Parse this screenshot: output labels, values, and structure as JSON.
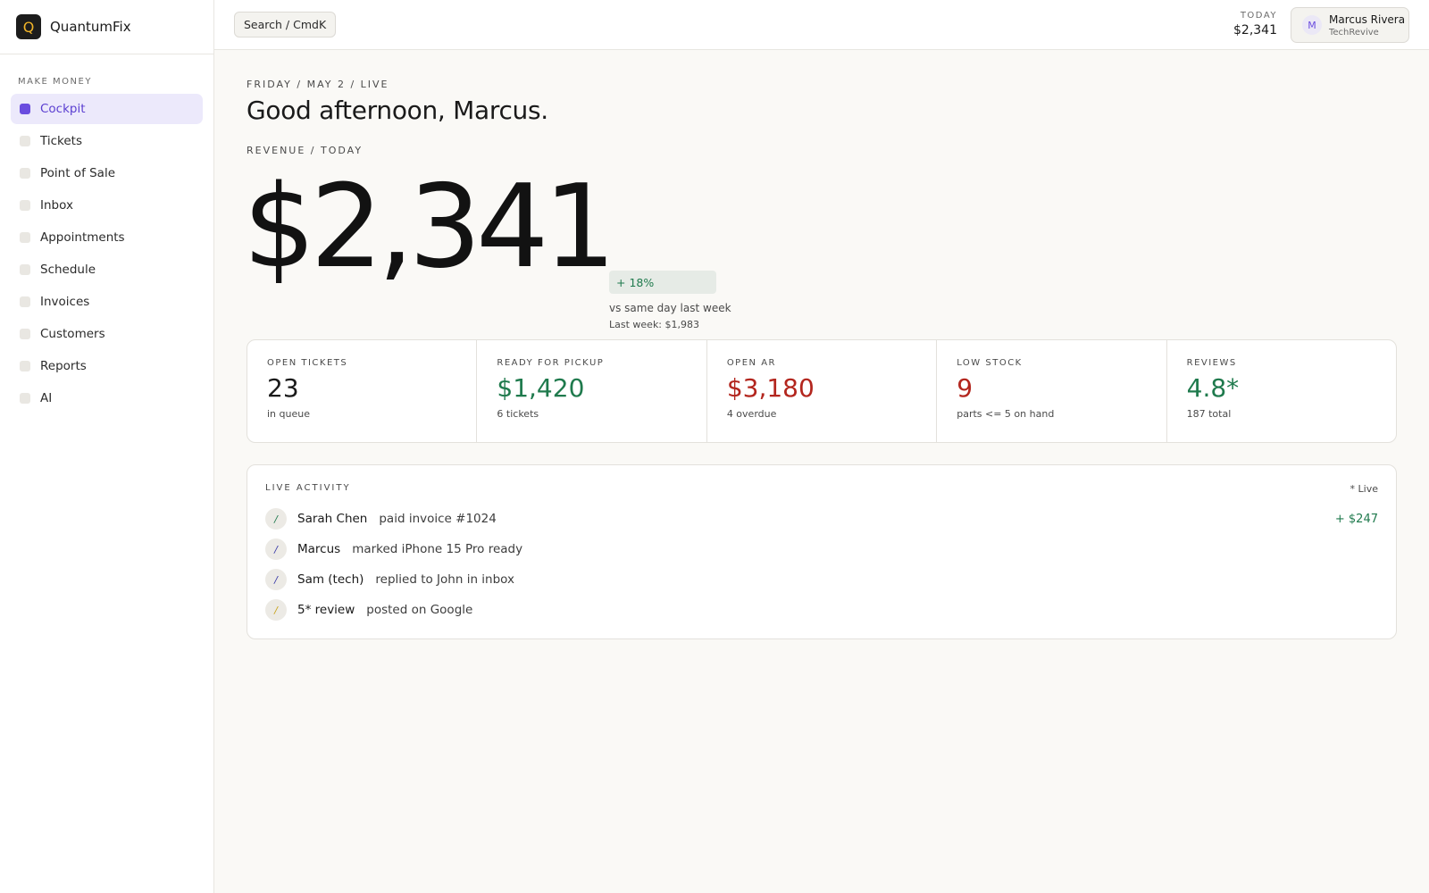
{
  "brand": {
    "logo_letter": "Q",
    "name": "QuantumFix"
  },
  "sidebar": {
    "section_label": "MAKE MONEY",
    "items": [
      {
        "label": "Cockpit",
        "active": true
      },
      {
        "label": "Tickets"
      },
      {
        "label": "Point of Sale"
      },
      {
        "label": "Inbox"
      },
      {
        "label": "Appointments"
      },
      {
        "label": "Schedule"
      },
      {
        "label": "Invoices"
      },
      {
        "label": "Customers"
      },
      {
        "label": "Reports"
      },
      {
        "label": "AI"
      }
    ]
  },
  "topbar": {
    "search_label": "Search / CmdK",
    "today_label": "TODAY",
    "today_value": "$2,341",
    "user": {
      "initial": "M",
      "name": "Marcus Rivera",
      "org": "TechRevive"
    }
  },
  "main": {
    "date_line": "FRIDAY / MAY 2 / LIVE",
    "greeting": "Good afternoon, Marcus.",
    "revenue_label": "REVENUE / TODAY",
    "revenue_value": "$2,341",
    "delta": "+ 18%",
    "delta_sub": "vs same day last week",
    "last_week": "Last week: $1,983"
  },
  "stats": [
    {
      "label": "OPEN TICKETS",
      "value": "23",
      "sub": "in queue",
      "tone": "neutral"
    },
    {
      "label": "READY FOR PICKUP",
      "value": "$1,420",
      "sub": "6 tickets",
      "tone": "green"
    },
    {
      "label": "OPEN AR",
      "value": "$3,180",
      "sub": "4 overdue",
      "tone": "red"
    },
    {
      "label": "LOW STOCK",
      "value": "9",
      "sub": "parts <= 5 on hand",
      "tone": "red"
    },
    {
      "label": "REVIEWS",
      "value": "4.8*",
      "sub": "187 total",
      "tone": "green"
    }
  ],
  "activity": {
    "title": "LIVE ACTIVITY",
    "live_label": "* Live",
    "rows": [
      {
        "icon": "/",
        "who": "Sarah Chen",
        "what": "paid invoice #1024",
        "amount": "+ $247"
      },
      {
        "icon": "/",
        "who": "Marcus",
        "what": "marked iPhone 15 Pro ready",
        "amount": ""
      },
      {
        "icon": "/",
        "who": "Sam (tech)",
        "what": "replied to John in inbox",
        "amount": ""
      },
      {
        "icon": "/",
        "who": "5* review",
        "what": "posted on Google",
        "amount": ""
      }
    ]
  },
  "colors": {
    "accent": "#6a4cdf",
    "positive": "#1f7a4d",
    "negative": "#b3261e",
    "background": "#faf9f6"
  }
}
